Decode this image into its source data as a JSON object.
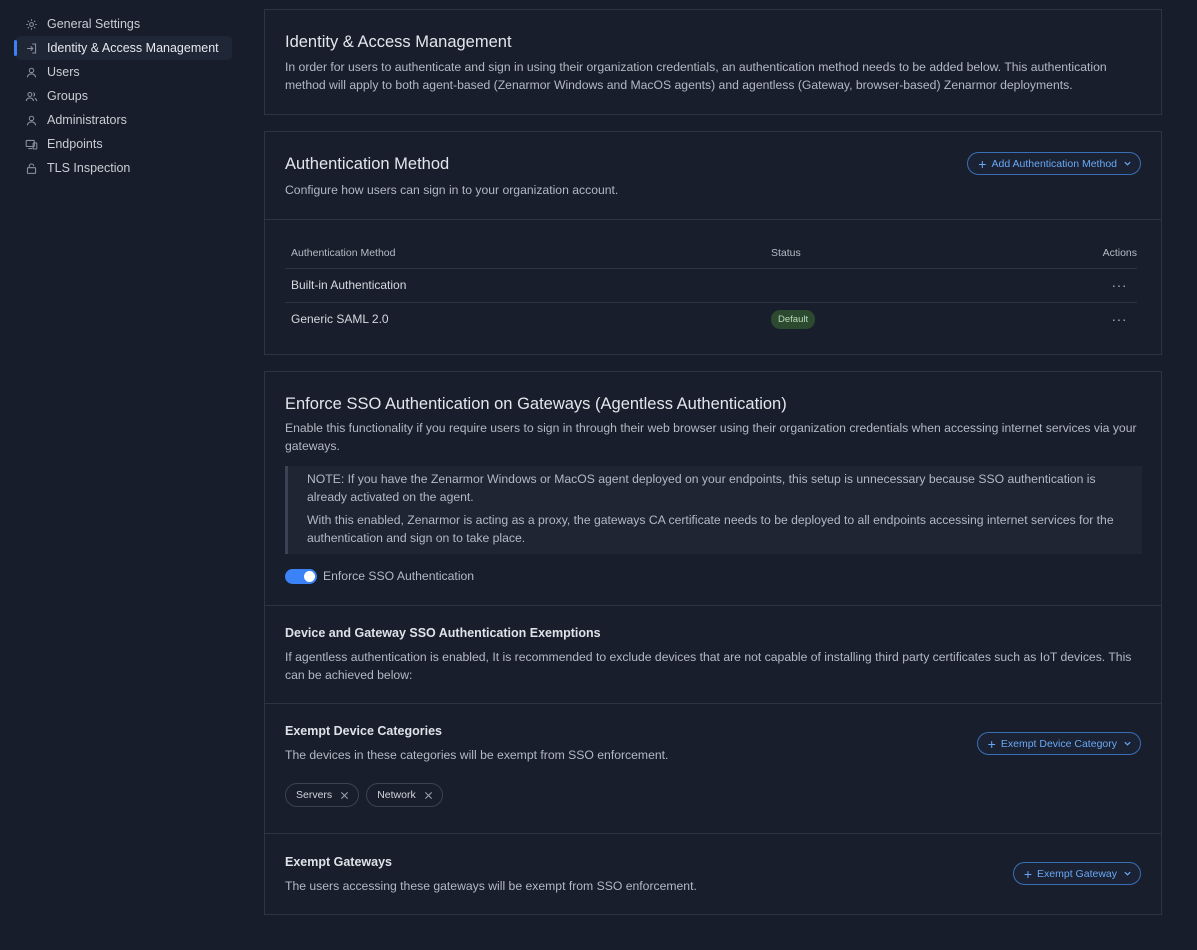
{
  "sidebar": {
    "items": [
      {
        "label": "General Settings",
        "icon": "gear-icon",
        "active": false
      },
      {
        "label": "Identity & Access Management",
        "icon": "sign-in-icon",
        "active": true
      },
      {
        "label": "Users",
        "icon": "user-icon",
        "active": false
      },
      {
        "label": "Groups",
        "icon": "users-icon",
        "active": false
      },
      {
        "label": "Administrators",
        "icon": "admin-icon",
        "active": false
      },
      {
        "label": "Endpoints",
        "icon": "devices-icon",
        "active": false
      },
      {
        "label": "TLS Inspection",
        "icon": "lock-icon",
        "active": false
      }
    ]
  },
  "iam": {
    "title": "Identity & Access Management",
    "description": "In order for users to authenticate and sign in using their organization credentials, an authentication method needs to be added below. This authentication method will apply to both agent-based (Zenarmor Windows and MacOS agents) and agentless (Gateway, browser-based) Zenarmor deployments."
  },
  "auth": {
    "title": "Authentication Method",
    "description": "Configure how users can sign in to your organization account.",
    "add_button": "Add Authentication Method",
    "columns": {
      "method": "Authentication Method",
      "status": "Status",
      "actions": "Actions"
    },
    "rows": [
      {
        "method": "Built-in Authentication",
        "status": "",
        "actions": "···"
      },
      {
        "method": "Generic SAML 2.0",
        "status": "Default",
        "actions": "···"
      }
    ]
  },
  "sso": {
    "title": "Enforce SSO Authentication on Gateways (Agentless Authentication)",
    "description": "Enable this functionality if you require users to sign in through their web browser using their organization credentials when accessing internet services via your gateways.",
    "note1": "NOTE: If you have the Zenarmor Windows or MacOS agent deployed on your endpoints, this setup is unnecessary because SSO authentication is already activated on the agent.",
    "note2": "With this enabled, Zenarmor is acting as a proxy, the gateways CA certificate needs to be deployed to all endpoints accessing internet services for the authentication and sign on to take place.",
    "toggle_label": "Enforce SSO Authentication",
    "toggle_on": true,
    "accent_color": "#3b82f6",
    "exemptions": {
      "title": "Device and Gateway SSO Authentication Exemptions",
      "description": "If agentless authentication is enabled, It is recommended to exclude devices that are not capable of installing third party certificates such as IoT devices. This can be achieved below:"
    },
    "device_categories": {
      "title": "Exempt Device Categories",
      "description": "The devices in these categories will be exempt from SSO enforcement.",
      "button": "Exempt Device Category",
      "chips": [
        "Servers",
        "Network"
      ]
    },
    "gateways": {
      "title": "Exempt Gateways",
      "description": "The users accessing these gateways will be exempt from SSO enforcement.",
      "button": "Exempt Gateway"
    }
  }
}
